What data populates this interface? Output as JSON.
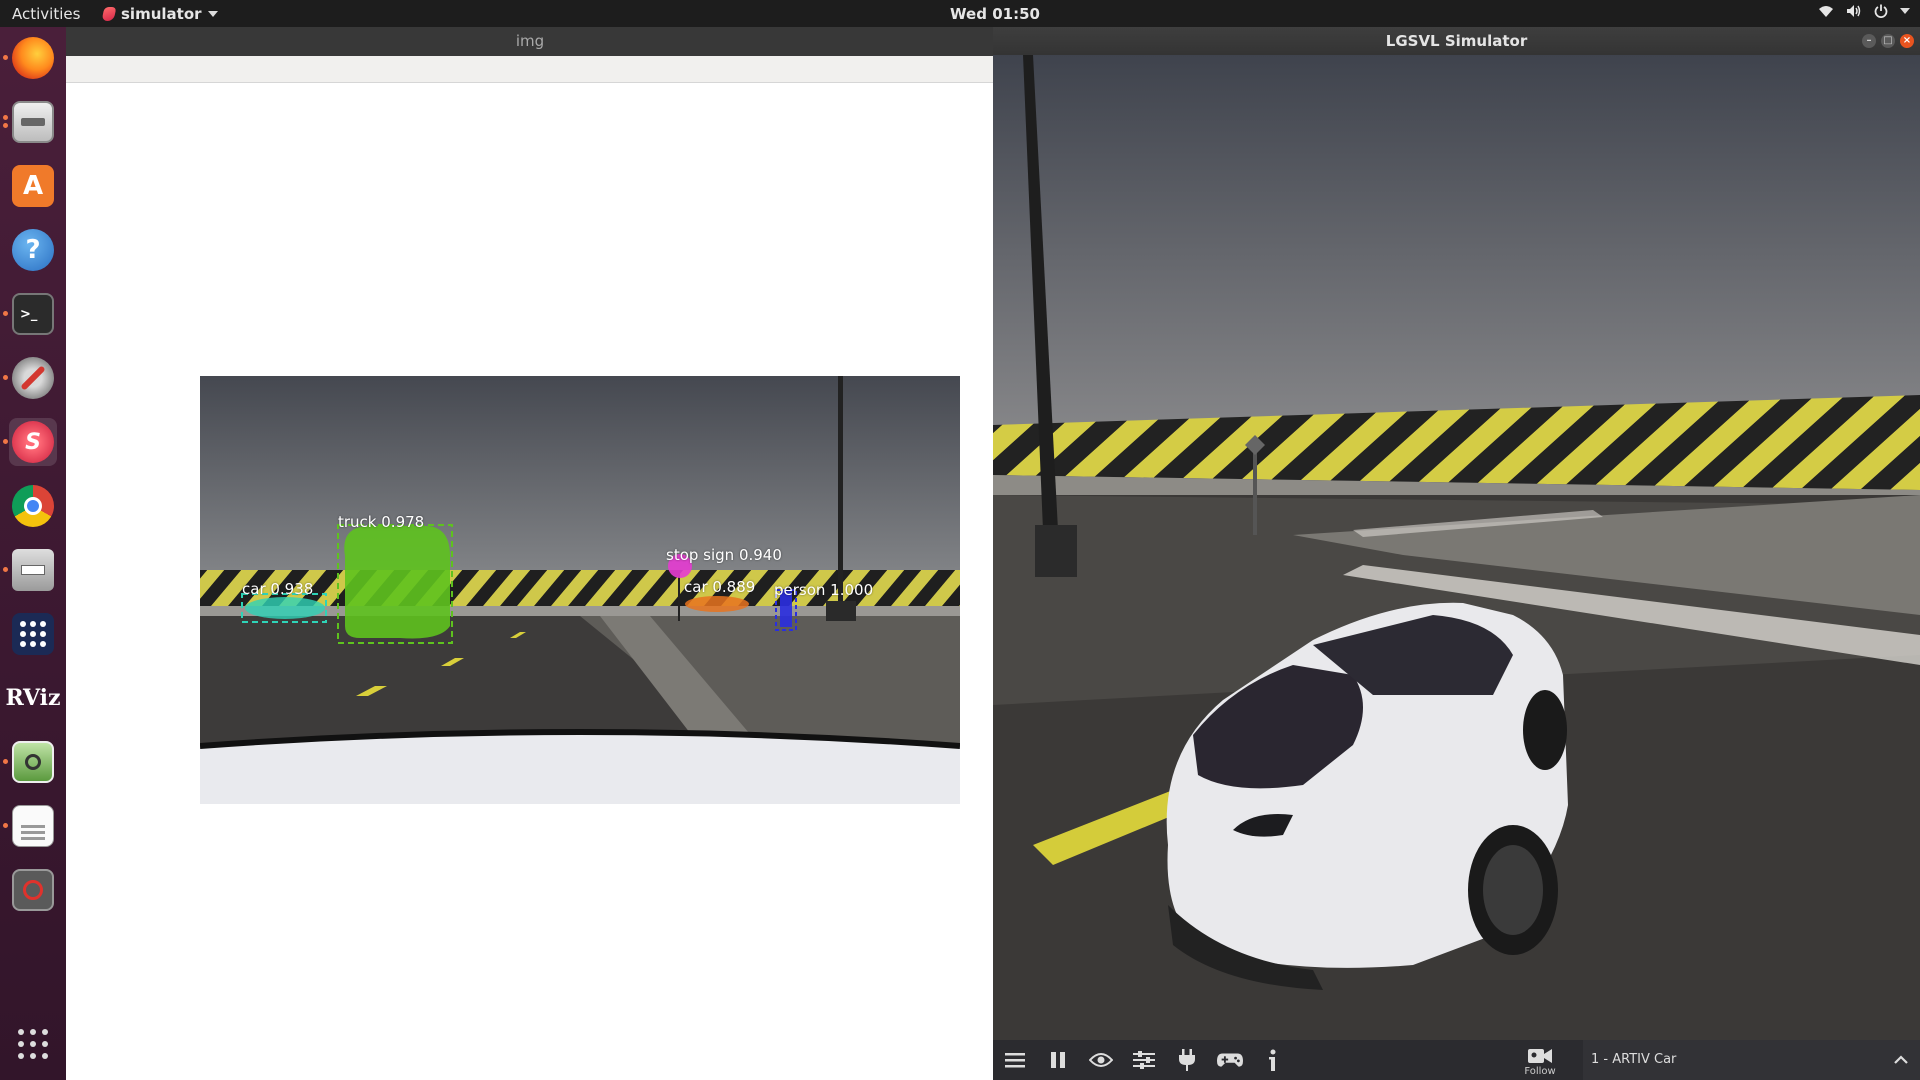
{
  "topbar": {
    "activities": "Activities",
    "app_name": "simulator",
    "clock": "Wed 01:50",
    "tray_icons": [
      "wifi-icon",
      "volume-icon",
      "power-icon"
    ]
  },
  "dock": {
    "items": [
      {
        "name": "firefox",
        "running": true
      },
      {
        "name": "files",
        "running": true
      },
      {
        "name": "software-center",
        "running": false
      },
      {
        "name": "help",
        "running": false
      },
      {
        "name": "terminal",
        "running": true
      },
      {
        "name": "system-tools",
        "running": true
      },
      {
        "name": "simulator",
        "running": true,
        "active": true
      },
      {
        "name": "chrome",
        "running": false
      },
      {
        "name": "printer",
        "running": true
      },
      {
        "name": "app-grid",
        "running": false
      },
      {
        "name": "rviz",
        "running": false,
        "label": "RViz"
      },
      {
        "name": "image-viewer",
        "running": true
      },
      {
        "name": "text-editor",
        "running": true
      },
      {
        "name": "blocked-app",
        "running": false
      }
    ],
    "show_apps": "show-applications-icon"
  },
  "img_window": {
    "title": "img",
    "detections": [
      {
        "label": "car 0.938",
        "color": "#2ed3b7"
      },
      {
        "label": "truck 0.978",
        "color": "#5ec21e"
      },
      {
        "label": "stop sign 0.940",
        "color": "#e63bd1"
      },
      {
        "label": "car 0.889",
        "color": "#e8731f"
      },
      {
        "label": "person 1.000",
        "color": "#2a2ee0"
      }
    ]
  },
  "sim_window": {
    "title": "LGSVL Simulator",
    "toolbar": {
      "buttons": [
        "menu-icon",
        "pause-icon",
        "eye-icon",
        "sliders-icon",
        "plug-icon",
        "gamepad-icon",
        "info-icon"
      ],
      "follow_label": "Follow",
      "vehicle_label": "1 - ARTIV Car"
    }
  }
}
